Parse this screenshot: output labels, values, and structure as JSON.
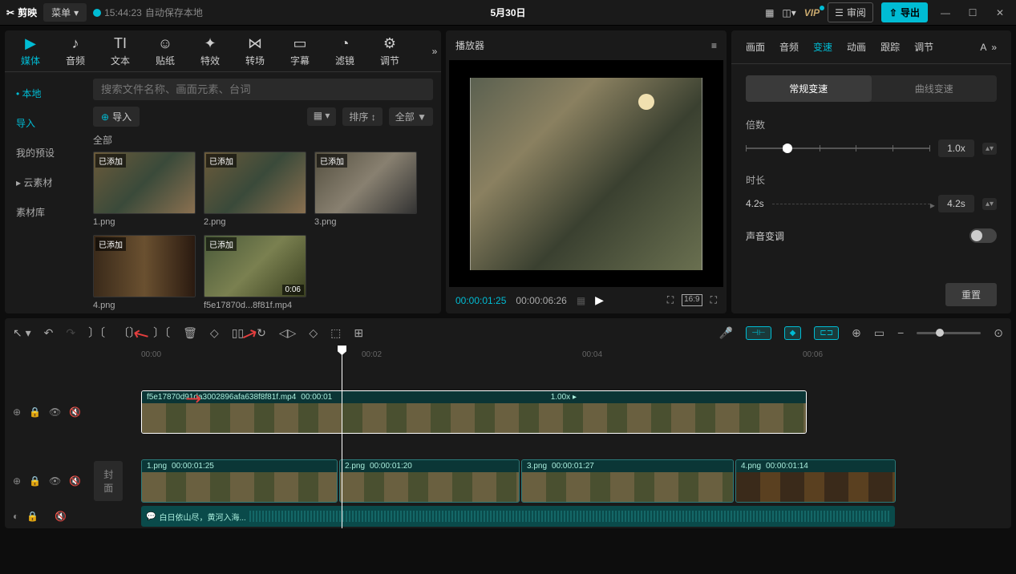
{
  "titlebar": {
    "app_name": "剪映",
    "menu_label": "菜单",
    "save_time": "15:44:23",
    "save_text": "自动保存本地",
    "project": "5月30日",
    "vip": "VIP",
    "review": "审阅",
    "export": "导出"
  },
  "media_tabs": [
    {
      "label": "媒体",
      "icon": "▶"
    },
    {
      "label": "音频",
      "icon": "♪"
    },
    {
      "label": "文本",
      "icon": "TI"
    },
    {
      "label": "贴纸",
      "icon": "☺"
    },
    {
      "label": "特效",
      "icon": "✦"
    },
    {
      "label": "转场",
      "icon": "⋈"
    },
    {
      "label": "字幕",
      "icon": "▭"
    },
    {
      "label": "滤镜",
      "icon": "◔"
    },
    {
      "label": "调节",
      "icon": "⚙"
    }
  ],
  "media_side": {
    "local": "本地",
    "import_nav": "导入",
    "presets": "我的预设",
    "cloud": "云素材",
    "library": "素材库"
  },
  "media": {
    "search_placeholder": "搜索文件名称、画面元素、台词",
    "import": "导入",
    "sort": "排序",
    "all": "全部",
    "all_header": "全部",
    "added": "已添加"
  },
  "thumbs": [
    {
      "name": "1.png",
      "added": true,
      "dur": ""
    },
    {
      "name": "2.png",
      "added": true,
      "dur": ""
    },
    {
      "name": "3.png",
      "added": true,
      "dur": ""
    },
    {
      "name": "4.png",
      "added": true,
      "dur": ""
    },
    {
      "name": "f5e17870d...8f81f.mp4",
      "added": true,
      "dur": "0:06"
    }
  ],
  "player": {
    "title": "播放器",
    "current": "00:00:01:25",
    "total": "00:00:06:26",
    "ratio": "16:9"
  },
  "props": {
    "tabs": [
      "画面",
      "音频",
      "变速",
      "动画",
      "跟踪",
      "调节"
    ],
    "active_tab": 2,
    "sub_normal": "常规变速",
    "sub_curve": "曲线变速",
    "multiplier_label": "倍数",
    "multiplier_val": "1.0x",
    "duration_label": "时长",
    "duration_from": "4.2s",
    "duration_to": "4.2s",
    "pitch_label": "声音变调",
    "reset": "重置"
  },
  "ruler": [
    "00:00",
    "00:02",
    "00:04",
    "00:06"
  ],
  "cover": "封面",
  "clips": {
    "video": {
      "name": "f5e17870d91da3002896afa638f8f81f.mp4",
      "time": "00:00:01",
      "speed": "1.00x"
    },
    "img1": {
      "name": "1.png",
      "time": "00:00:01:25"
    },
    "img2": {
      "name": "2.png",
      "time": "00:00:01:20"
    },
    "img3": {
      "name": "3.png",
      "time": "00:00:01:27"
    },
    "img4": {
      "name": "4.png",
      "time": "00:00:01:14"
    },
    "audio_text": "白日依山尽，黄河入海..."
  }
}
